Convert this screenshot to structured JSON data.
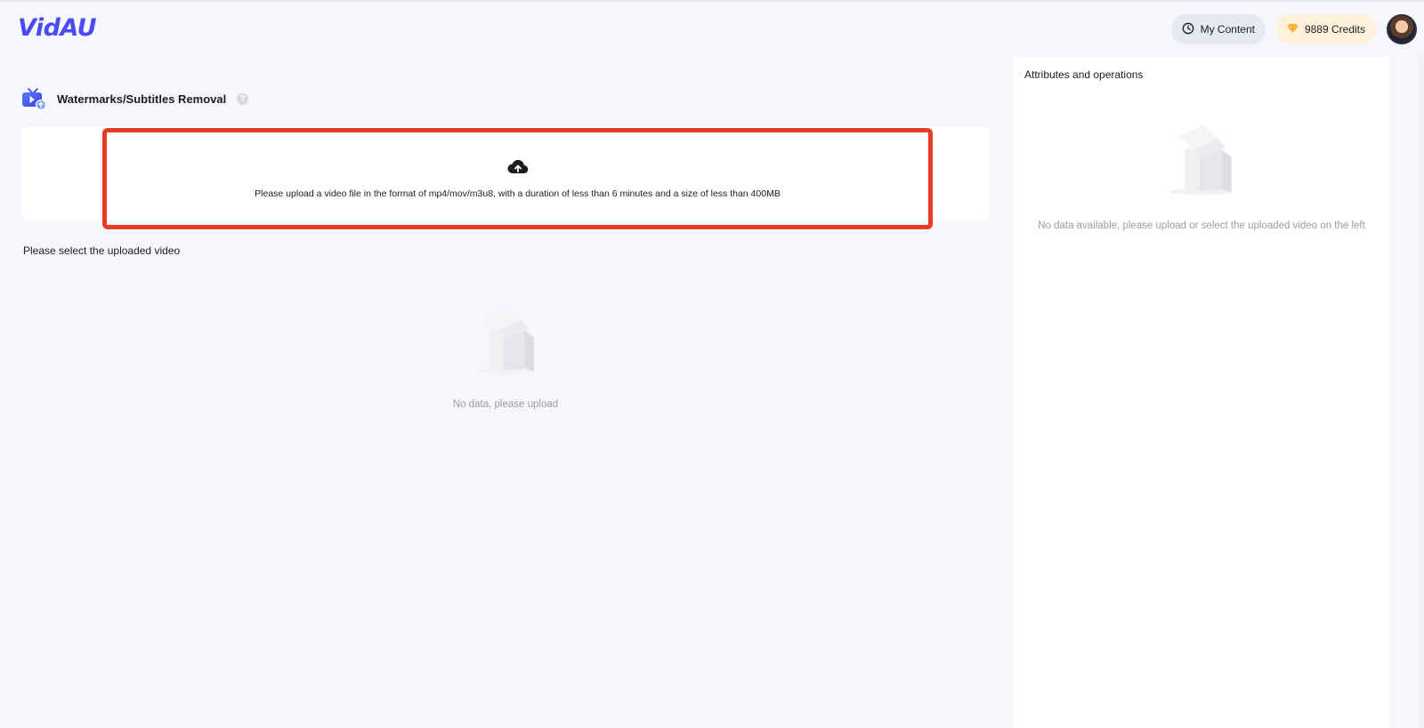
{
  "header": {
    "logo": "VidAU",
    "my_content_label": "My Content",
    "credits_label": "9889 Credits"
  },
  "tool": {
    "title": "Watermarks/Subtitles Removal",
    "help": "?"
  },
  "upload": {
    "instructions": "Please upload a video file in the format of mp4/mov/m3u8, with a duration of less than 6 minutes and a size of less than 400MB"
  },
  "videos": {
    "section_label": "Please select the uploaded video",
    "empty_text": "No data, please upload"
  },
  "side_panel": {
    "title": "Attributes and operations",
    "empty_text": "No data available, please upload or select the uploaded video on the left"
  },
  "colors": {
    "brand": "#4b4cf0",
    "highlight_frame": "#ea3b24",
    "credits_bg": "#fff1da",
    "gem": "#f5a623"
  },
  "icons": {
    "my_content": "clock-icon",
    "credits": "gem-icon",
    "upload": "cloud-upload-icon",
    "empty": "empty-box-icon"
  }
}
